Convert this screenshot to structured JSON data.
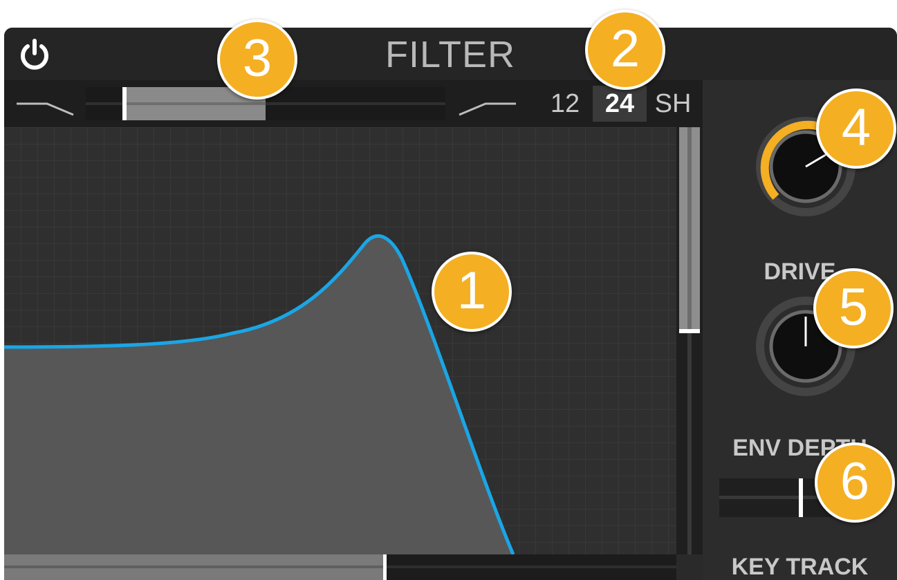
{
  "panel": {
    "title": "FILTER"
  },
  "slopes": {
    "options": [
      "12",
      "24",
      "SH"
    ],
    "selected": "24"
  },
  "knobs": {
    "drive_label": "DRIVE",
    "env_depth_label": "ENV DEPTH",
    "key_track_label": "KEY TRACK"
  },
  "badges": [
    "1",
    "2",
    "3",
    "4",
    "5",
    "6"
  ],
  "colors": {
    "accent": "#f4af23",
    "curve": "#1aa6e6",
    "panel": "#2a2a2a"
  },
  "icons": {
    "power": "power-icon",
    "lowpass": "lowpass-shape-icon",
    "highpass": "highpass-shape-icon"
  }
}
